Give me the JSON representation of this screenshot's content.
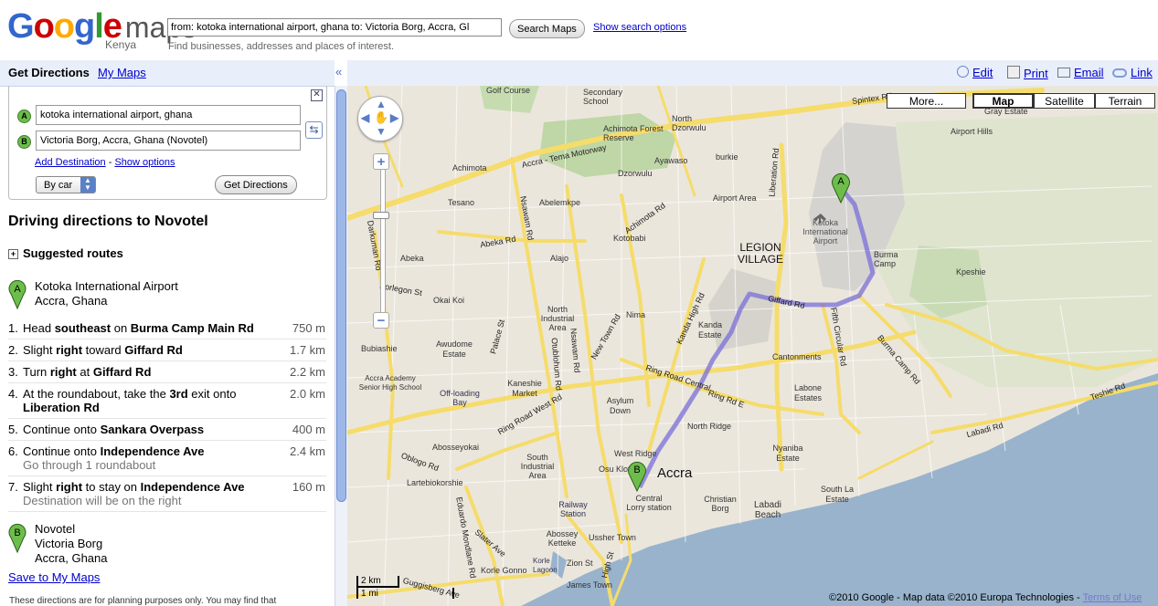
{
  "header": {
    "logo_google": "Google",
    "logo_maps": "maps",
    "logo_country": "Kenya",
    "search_value": "from: kotoka international airport, ghana to: Victoria Borg, Accra, Gl",
    "search_button": "Search Maps",
    "search_options_link": "Show search options",
    "search_hint": "Find businesses, addresses and places of interest."
  },
  "panel": {
    "tab_get_directions": "Get Directions",
    "tab_my_maps": "My Maps",
    "collapse_icon": "«",
    "from_marker": "A",
    "from_value": "kotoka international airport, ghana",
    "to_marker": "B",
    "to_value": "Victoria Borg, Accra, Ghana (Novotel)",
    "add_destination": "Add Destination",
    "separator": "-",
    "show_options": "Show options",
    "mode": "By car",
    "get_directions_button": "Get Directions",
    "driving_title": "Driving directions to Novotel",
    "suggested_routes": "Suggested routes",
    "start": {
      "marker": "A",
      "line1": "Kotoka International Airport",
      "line2": "Accra, Ghana"
    },
    "steps": [
      {
        "num": "1.",
        "html": "Head <b>southeast</b> on <b>Burma Camp Main Rd</b>",
        "dist": "750 m",
        "sub": ""
      },
      {
        "num": "2.",
        "html": "Slight <b>right</b> toward <b>Giffard Rd</b>",
        "dist": "1.7 km",
        "sub": ""
      },
      {
        "num": "3.",
        "html": "Turn <b>right</b> at <b>Giffard Rd</b>",
        "dist": "2.2 km",
        "sub": ""
      },
      {
        "num": "4.",
        "html": "At the roundabout, take the <b>3rd</b> exit onto<br><span style=\"padding-left:16px\"><b>Liberation Rd</b></span>",
        "dist": "2.0 km",
        "sub": ""
      },
      {
        "num": "5.",
        "html": "Continue onto <b>Sankara Overpass</b>",
        "dist": "400 m",
        "sub": ""
      },
      {
        "num": "6.",
        "html": "Continue onto <b>Independence Ave</b>",
        "dist": "2.4 km",
        "sub": "Go through 1 roundabout"
      },
      {
        "num": "7.",
        "html": "Slight <b>right</b> to stay on <b>Independence Ave</b>",
        "dist": "160 m",
        "sub": "Destination will be on the right"
      }
    ],
    "end": {
      "marker": "B",
      "line1": "Novotel",
      "line2": "Victoria Borg",
      "line3": "Accra, Ghana"
    },
    "save_link": "Save to My Maps",
    "disclaimer": "These directions are for planning purposes only. You may find that"
  },
  "toolbar": {
    "edit": "Edit",
    "print": "Print",
    "email": "Email",
    "link": "Link"
  },
  "map": {
    "more_button": "More...",
    "type_map": "Map",
    "type_satellite": "Satellite",
    "type_terrain": "Terrain",
    "marker_a": "A",
    "marker_b": "B",
    "scale_km": "2 km",
    "scale_mi": "1 mi",
    "copyright": "©2010 Google - Map data ©2010 Europa Technologies -",
    "terms": "Terms of Use",
    "labels": {
      "golf_course": "Golf Course",
      "secondary_school": "Secondary School",
      "achimota_forest": "Achimota Forest Reserve",
      "north_dzorwulu": "North Dzorwulu",
      "airport_hills": "Airport Hills",
      "gray_estate": "Gray Estate",
      "achimota": "Achimota",
      "ayawaso": "Ayawaso",
      "burkie": "burkie",
      "dzorwulu": "Dzorwulu",
      "tesano": "Tesano",
      "abelenkpe": "Abelemkpe",
      "airport_area": "Airport Area",
      "kotokabi": "Kotobabi",
      "abeka": "Abeka",
      "alajo": "Alajo",
      "legion_village": "LEGION VILLAGE",
      "kotoka_airport": "Kotoka International Airport",
      "burma_camp": "Burma Camp",
      "kpeshie": "Kpeshie",
      "okai_koi": "Okai Koi",
      "north_industrial": "North Industrial Area",
      "nima": "Nima",
      "kanda_estate": "Kanda Estate",
      "awudome": "Awudome Estate",
      "bubiashie": "Bubiashie",
      "cantonments": "Cantonments",
      "accra_academy": "Accra Academy Senior High School",
      "offlading_bay": "Off-loading Bay",
      "kaneshie_market": "Kaneshie Market",
      "asylum_down": "Asylum Down",
      "labone": "Labone Estates",
      "north_ridge": "North Ridge",
      "abossey_okai": "Abosseyokai",
      "south_industrial": "South Industrial Area",
      "west_ridge": "West Ridge",
      "nyaniba": "Nyaniba Estate",
      "osu_klottey": "Osu Klottey",
      "accra": "Accra",
      "south_la": "South La Estate",
      "lartebiokorshie": "Lartebiokorshie",
      "central_lorry": "Central Lorry station",
      "christian_borg": "Christian Borg",
      "labadi_beach": "Labadi Beach",
      "railway_station": "Railway Station",
      "abossey": "Abossey Ketteke",
      "ussher_town": "Ussher Town",
      "korle": "Korle Lagoon",
      "james_town": "James Town",
      "korle_gonno": "Korle Gonno",
      "zion": "Zion St"
    },
    "roads": {
      "accra_tema": "Accra - Tema Motorway",
      "spintex": "Spintex Rd",
      "liberation": "Liberation Rd",
      "achimota_rd": "Achimota Rd",
      "kotobabi_rd": "Kotobabi Rd",
      "nsawam": "Nsawam Rd",
      "abeka_rd": "Abeka Rd",
      "dansoman": "Darkuman Rd",
      "korlegon": "Korlegon St",
      "giffard": "Giffard Rd",
      "fifth_circular": "Fifth Circular Rd",
      "burma_camp_rd": "Burma Camp Rd",
      "kanda_high": "Kanda High Rd",
      "new_town": "New Town Rd",
      "palace": "Palace St",
      "otublohum": "Otublohum Rd",
      "nsawam2": "Nsawam Rd",
      "ring_road_central": "Ring Road Central",
      "ring_rd_e": "Ring Rd E",
      "ring_road_west": "Ring Road West Rd",
      "oblogo": "Oblogo Rd",
      "teshie": "Teshie Rd",
      "labadi": "Labadi Rd",
      "high_st": "High St",
      "slater": "Slater Ave",
      "guggisberg": "Guggisberg Ave",
      "eduardo": "Eduardo Mondlane Rd"
    }
  }
}
